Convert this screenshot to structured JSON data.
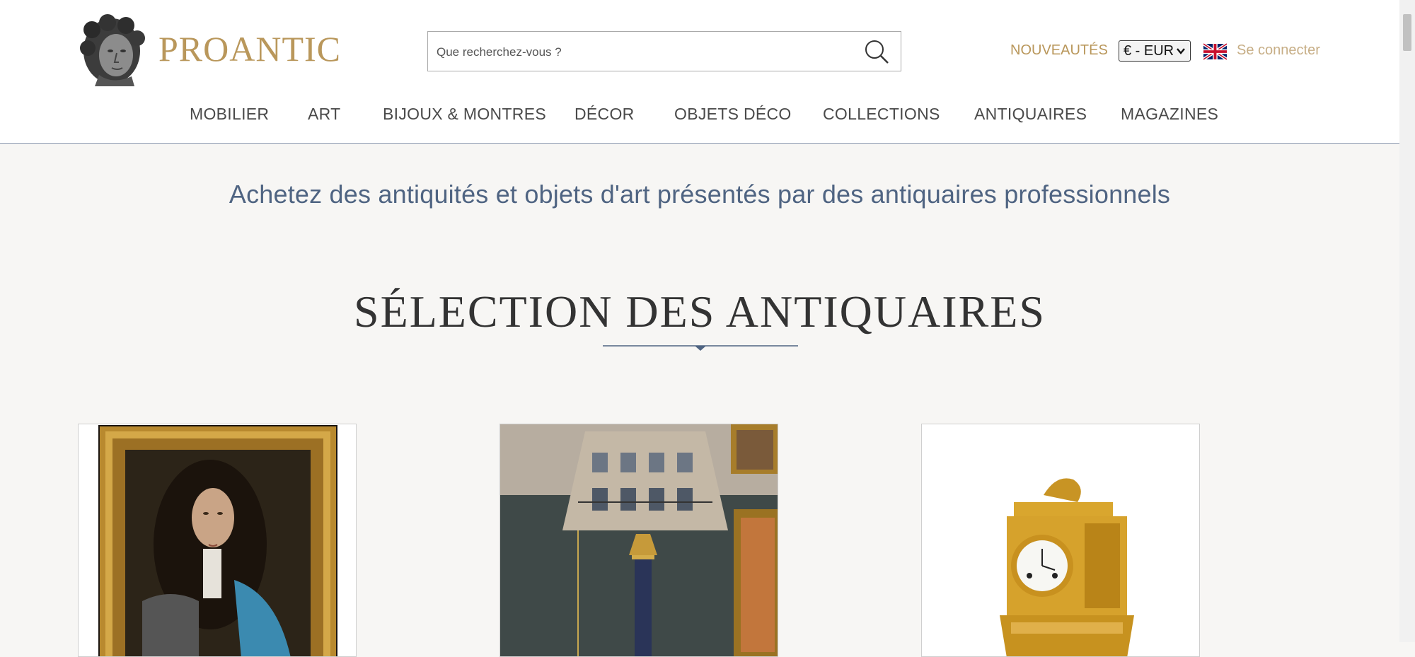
{
  "header": {
    "brand": "PROANTIC",
    "search_placeholder": "Que recherchez-vous ?",
    "nouveautes": "NOUVEAUTÉS",
    "currency": "€ - EUR",
    "language_flag": "uk-flag-icon",
    "login": "Se connecter"
  },
  "nav": {
    "items": [
      {
        "label": "MOBILIER"
      },
      {
        "label": "ART"
      },
      {
        "label": "BIJOUX & MONTRES"
      },
      {
        "label": "DÉCOR"
      },
      {
        "label": "OBJETS DÉCO"
      },
      {
        "label": "COLLECTIONS"
      },
      {
        "label": "ANTIQUAIRES"
      },
      {
        "label": "MAGAZINES"
      }
    ]
  },
  "main": {
    "tagline": "Achetez des antiquités et objets d'art présentés par des antiquaires professionnels",
    "section_title": "SÉLECTION DES ANTIQUAIRES"
  },
  "cards": [
    {
      "image": "portrait-painting-image"
    },
    {
      "image": "table-lamp-image"
    },
    {
      "image": "gilt-bronze-clock-image"
    }
  ],
  "colors": {
    "brand_gold": "#b9975b",
    "tagline_blue": "#4f6482",
    "background": "#f7f6f4"
  }
}
